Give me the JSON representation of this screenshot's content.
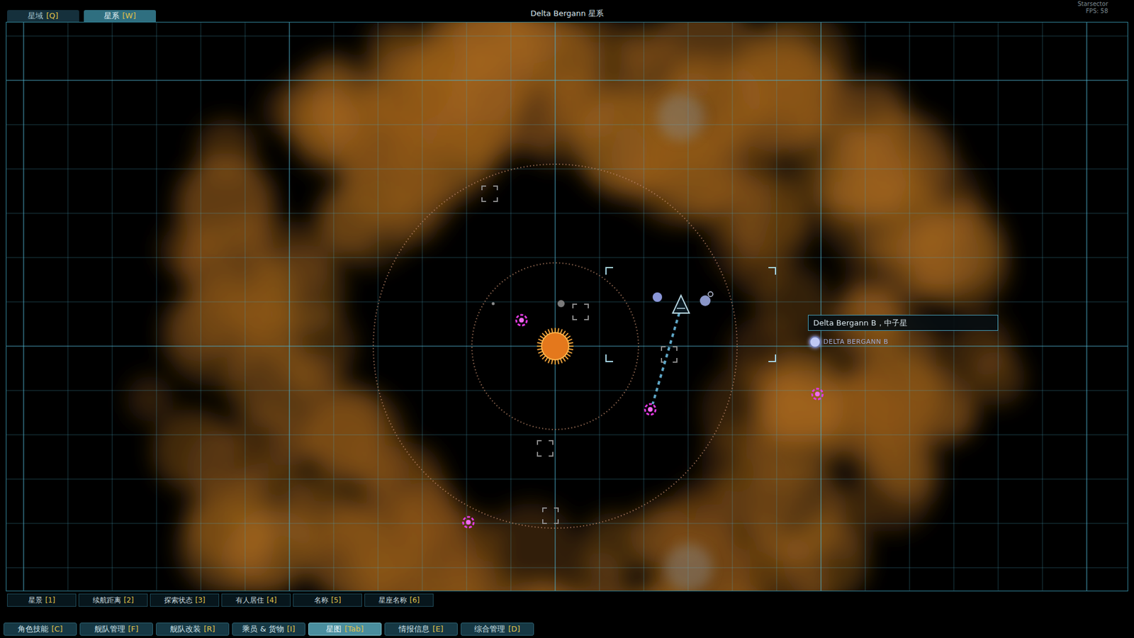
{
  "window": {
    "title": "Delta Bergann 星系",
    "version": "Starsector",
    "fps": "FPS: 58"
  },
  "tabs": [
    {
      "label": "星域",
      "key": "[Q]",
      "selected": false
    },
    {
      "label": "星系",
      "key": "[W]",
      "selected": true
    }
  ],
  "map": {
    "tooltip": "Delta Bergann B，中子星",
    "label": "DELTA BERGANN B"
  },
  "filters": [
    {
      "label": "星景",
      "key": "[1]"
    },
    {
      "label": "续航距离",
      "key": "[2]"
    },
    {
      "label": "探索状态",
      "key": "[3]"
    },
    {
      "label": "有人居住",
      "key": "[4]"
    },
    {
      "label": "名称",
      "key": "[5]"
    },
    {
      "label": "星座名称",
      "key": "[6]"
    }
  ],
  "nav": [
    {
      "label": "角色技能",
      "key": "[C]",
      "selected": false
    },
    {
      "label": "舰队管理",
      "key": "[F]",
      "selected": false
    },
    {
      "label": "舰队改装",
      "key": "[R]",
      "selected": false
    },
    {
      "label": "乘员 & 货物",
      "key": "[I]",
      "selected": false
    },
    {
      "label": "星图",
      "key": "[Tab]",
      "selected": true
    },
    {
      "label": "情报信息",
      "key": "[E]",
      "selected": false
    },
    {
      "label": "综合管理",
      "key": "[D]",
      "selected": false
    }
  ]
}
